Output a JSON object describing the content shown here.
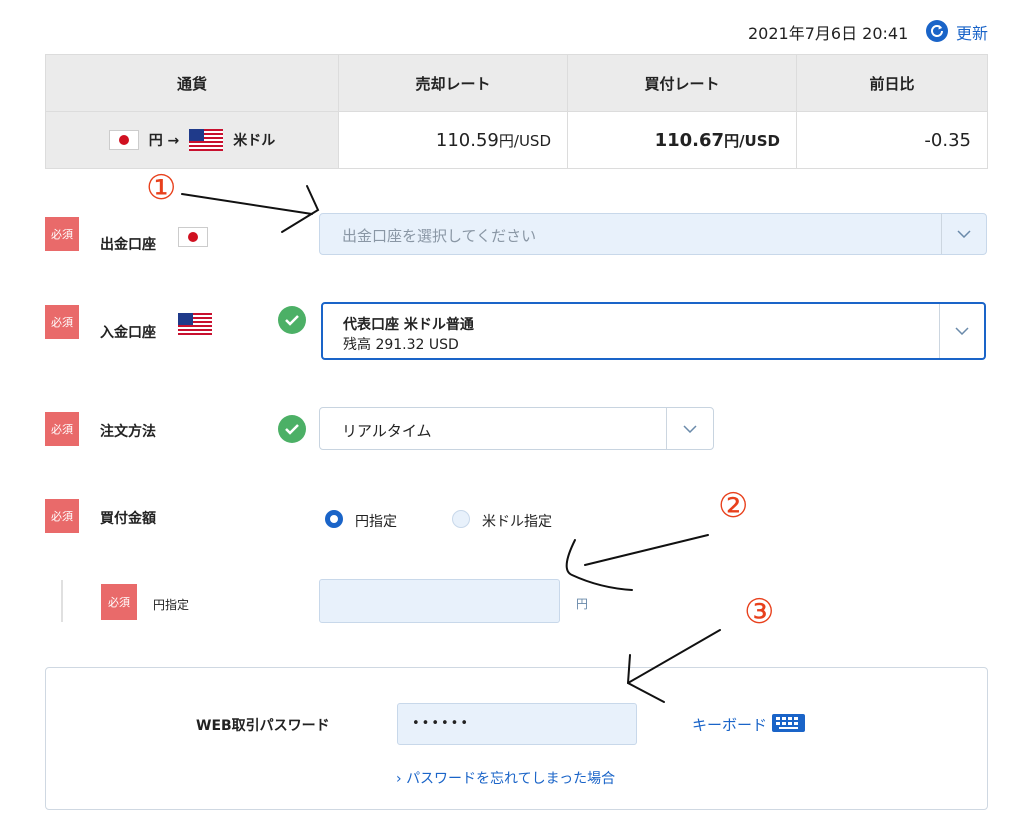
{
  "header": {
    "datetime": "2021年7月6日 20:41",
    "refresh_label": "更新",
    "refresh_icon": "refresh-icon"
  },
  "rate_table": {
    "headers": [
      "通貨",
      "売却レート",
      "買付レート",
      "前日比"
    ],
    "pair": {
      "from": "円 →",
      "to": "米ドル"
    },
    "sell_rate": "110.59",
    "sell_unit": "円/USD",
    "buy_rate": "110.67",
    "buy_unit": "円/USD",
    "change": "-0.35"
  },
  "form": {
    "required_badge": "必須",
    "withdraw_account": {
      "label": "出金口座",
      "placeholder": "出金口座を選択してください"
    },
    "deposit_account": {
      "label": "入金口座",
      "name": "代表口座 米ドル普通",
      "balance": "残高 291.32 USD"
    },
    "order_method": {
      "label": "注文方法",
      "value": "リアルタイム"
    },
    "buy_amount": {
      "label": "買付金額",
      "options": [
        "円指定",
        "米ドル指定"
      ],
      "selected": "円指定"
    },
    "yen_amount": {
      "label": "円指定",
      "value": "",
      "unit": "円"
    }
  },
  "password_panel": {
    "label": "WEB取引パスワード",
    "value": "••••••",
    "keyboard_label": "キーボード",
    "forgot_link": "パスワードを忘れてしまった場合"
  },
  "annotations": [
    "①",
    "②",
    "③"
  ],
  "colors": {
    "accent": "#1a64c8",
    "required": "#e96a6a",
    "check": "#4cb066",
    "annotation": "#e8401c"
  }
}
